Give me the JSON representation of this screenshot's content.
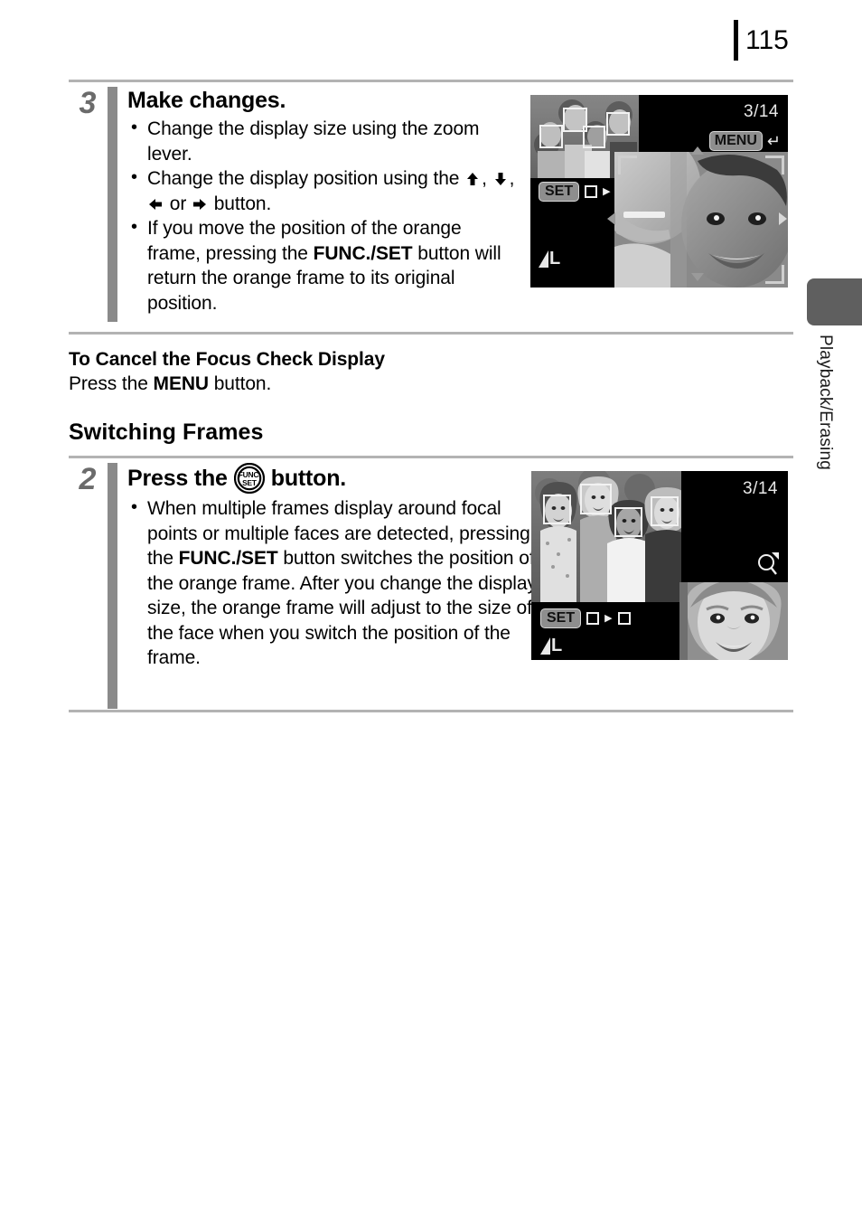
{
  "page": {
    "number": "115",
    "side_tab_label": "Playback/Erasing"
  },
  "steps": [
    {
      "number": "3",
      "title": "Make changes.",
      "bullets": [
        {
          "parts": [
            {
              "type": "text",
              "value": "Change the display size using the zoom lever."
            }
          ]
        },
        {
          "parts": [
            {
              "type": "text",
              "value": "Change the display position using the "
            },
            {
              "type": "icon",
              "value": "arrow-up-icon"
            },
            {
              "type": "text",
              "value": ", "
            },
            {
              "type": "icon",
              "value": "arrow-down-icon"
            },
            {
              "type": "text",
              "value": ", "
            },
            {
              "type": "icon",
              "value": "arrow-left-icon"
            },
            {
              "type": "text",
              "value": " or "
            },
            {
              "type": "icon",
              "value": "arrow-right-icon"
            },
            {
              "type": "text",
              "value": " button."
            }
          ]
        },
        {
          "parts": [
            {
              "type": "text",
              "value": "If you move the position of the orange frame, pressing the "
            },
            {
              "type": "bold",
              "value": "FUNC./SET"
            },
            {
              "type": "text",
              "value": " button will return the orange frame to its original position."
            }
          ]
        }
      ]
    },
    {
      "number": "2",
      "title_before": "Press the",
      "title_icon": "func-set-icon",
      "title_after": "button.",
      "bullets": [
        {
          "parts": [
            {
              "type": "text",
              "value": "When multiple frames display around focal points or multiple faces are detected, pressing the "
            },
            {
              "type": "bold",
              "value": "FUNC./SET"
            },
            {
              "type": "text",
              "value": " button switches the position of the orange frame. After you change the display size, the orange frame will adjust to the size of the face when you switch the position of the frame."
            }
          ]
        }
      ]
    }
  ],
  "cancel_section": {
    "heading": "To Cancel the Focus Check Display",
    "line_before": "Press the ",
    "line_bold": "MENU",
    "line_after": " button."
  },
  "section_title": "Switching Frames",
  "lcd_top": {
    "counter": "3/14",
    "menu_label": "MENU",
    "return_icon": "return-arrow-icon",
    "set_label": "SET",
    "set_indicator": "box-to-box-icon",
    "quality_label": "L",
    "quality_icon": "fine-quality-icon"
  },
  "lcd_bottom": {
    "counter": "3/14",
    "set_label": "SET",
    "set_indicator": "box-to-box-icon",
    "magnify_icon": "magnifier-icon",
    "quality_label": "L",
    "quality_icon": "fine-quality-icon"
  },
  "colors": {
    "rule": "#b3b3b3",
    "step_bar": "#8a8a8a",
    "step_number": "#6b6b6b",
    "side_tab": "#5f5f5f",
    "lcd_bg": "#000000"
  }
}
